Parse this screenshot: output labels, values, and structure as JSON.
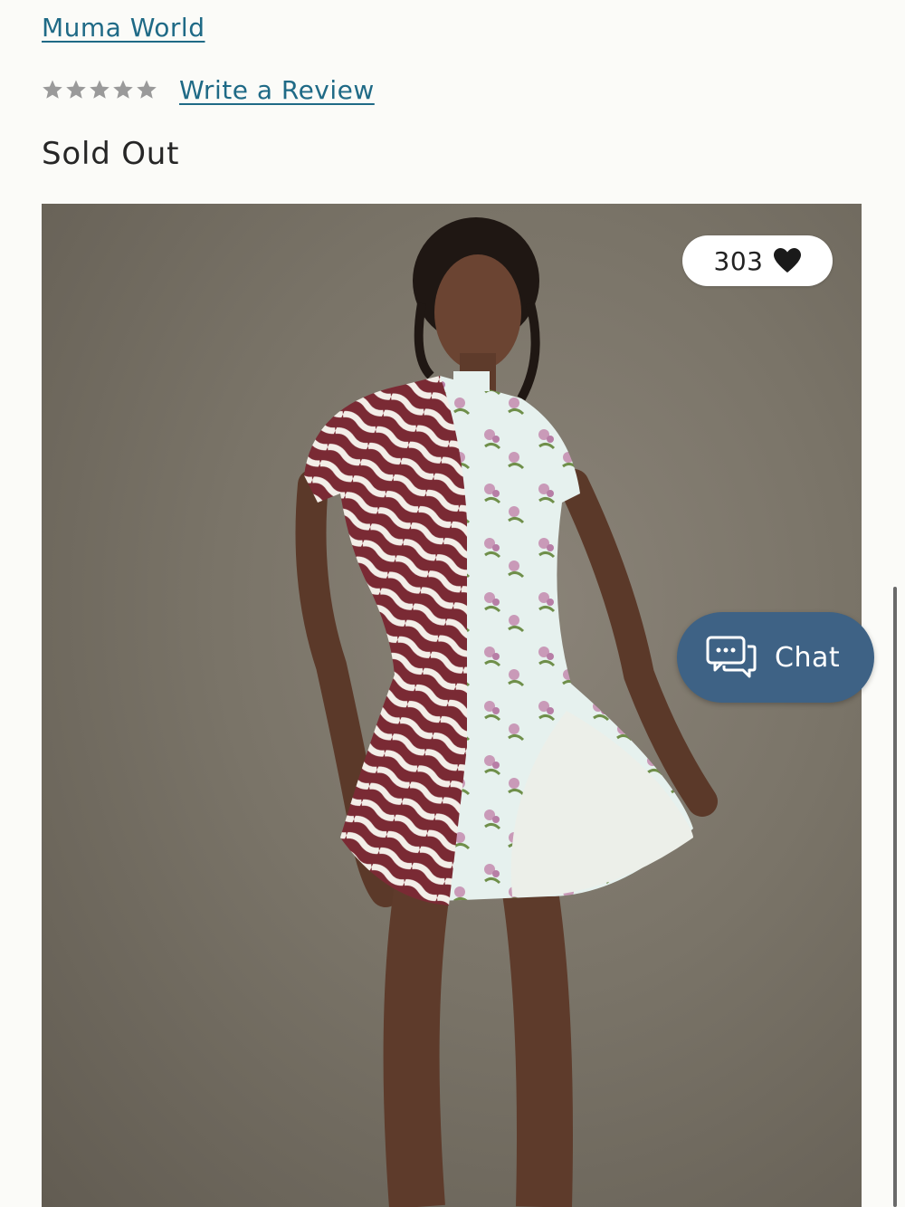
{
  "brand": {
    "label": "Muma World"
  },
  "rating": {
    "stars": 5,
    "filled": 0,
    "star_color": "#9a9a9a",
    "write_review_label": "Write a Review"
  },
  "status": {
    "label": "Sold Out"
  },
  "product_image": {
    "alt": "Model wearing printed mini dress"
  },
  "likes": {
    "count": "303",
    "icon": "heart-icon"
  },
  "chat": {
    "label": "Chat",
    "icon": "chat-bubbles-icon",
    "color": "#3e6285"
  },
  "colors": {
    "link": "#1f6a86",
    "text": "#262626",
    "background": "#fbfbf8"
  }
}
